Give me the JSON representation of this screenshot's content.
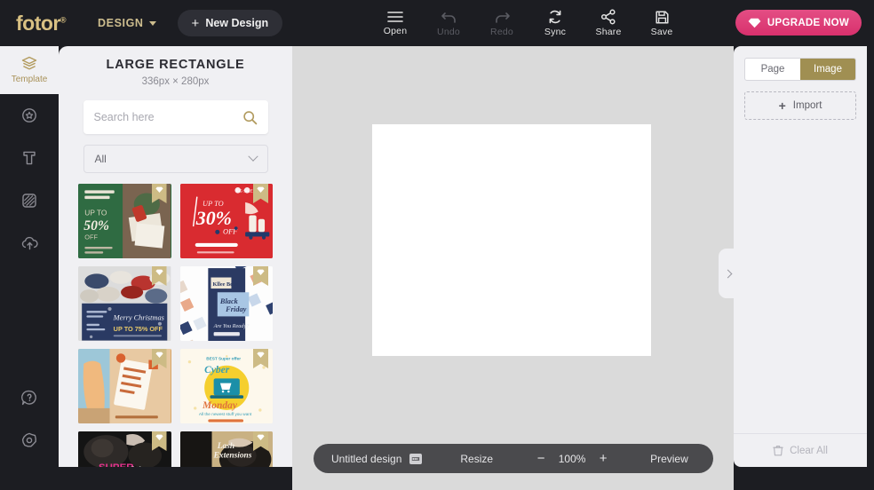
{
  "topbar": {
    "logo": "fotor",
    "logo_reg": "®",
    "design_menu": "DESIGN",
    "new_design": "New Design",
    "new_design_plus": "+",
    "tools": [
      {
        "label": "Open",
        "icon": "hamburger-menu-icon",
        "disabled": false
      },
      {
        "label": "Undo",
        "icon": "undo-arrow-icon",
        "disabled": true
      },
      {
        "label": "Redo",
        "icon": "redo-arrow-icon",
        "disabled": true
      },
      {
        "label": "Sync",
        "icon": "sync-refresh-icon",
        "disabled": false
      },
      {
        "label": "Share",
        "icon": "share-nodes-icon",
        "disabled": false
      },
      {
        "label": "Save",
        "icon": "floppy-disk-icon",
        "disabled": false
      }
    ],
    "upgrade_label": "UPGRADE NOW",
    "upgrade_icon": "diamond-icon",
    "upgrade_color": "#d8306d"
  },
  "rail": {
    "items": [
      {
        "label": "Template",
        "icon": "layers-stack-icon",
        "active": true
      },
      {
        "label": "",
        "icon": "sticker-badge-icon",
        "active": false
      },
      {
        "label": "",
        "icon": "text-T-icon",
        "active": false
      },
      {
        "label": "",
        "icon": "background-pattern-icon",
        "active": false
      },
      {
        "label": "",
        "icon": "cloud-upload-icon",
        "active": false
      }
    ],
    "bottom": [
      {
        "label": "",
        "icon": "help-question-icon"
      },
      {
        "label": "",
        "icon": "settings-gear-icon"
      }
    ]
  },
  "panel": {
    "title": "LARGE RECTANGLE",
    "subtitle": "336px × 280px",
    "search": {
      "value": "",
      "placeholder": "Search here",
      "icon": "search-magnifier-icon"
    },
    "filter": {
      "value": "All",
      "icon": "chevron-down-icon"
    },
    "badge_icon": "premium-diamond-icon",
    "templates": [
      {
        "name": "christmas-green-50-off",
        "style": "t-green",
        "wide": false,
        "premium": true
      },
      {
        "name": "red-up-to-30-percent-off",
        "style": "t-red",
        "wide": false,
        "premium": true
      },
      {
        "name": "merry-christmas-sneakers",
        "style": "t-navy",
        "wide": false,
        "premium": true
      },
      {
        "name": "black-friday-blue",
        "style": "t-bf",
        "wide": false,
        "premium": true
      },
      {
        "name": "dress-sale-tag",
        "style": "t-dress",
        "wide": false,
        "premium": true
      },
      {
        "name": "cyber-monday-yellow",
        "style": "t-cyber",
        "wide": false,
        "premium": true
      },
      {
        "name": "super-sale-dark",
        "style": "t-super",
        "wide": true,
        "premium": true
      },
      {
        "name": "lash-extensions-tan",
        "style": "t-lash",
        "wide": true,
        "premium": true
      }
    ]
  },
  "bottombar": {
    "design_name": "Untitled design",
    "rename_icon": "rename-edit-icon",
    "resize": "Resize",
    "zoom_out": "−",
    "zoom_value": "100%",
    "zoom_in": "+",
    "preview": "Preview"
  },
  "right": {
    "tabs": [
      {
        "label": "Page",
        "active": false
      },
      {
        "label": "Image",
        "active": true
      }
    ],
    "import": {
      "label": "Import",
      "plus": "+"
    },
    "clear_all": {
      "label": "Clear All",
      "icon": "trash-bin-icon"
    },
    "handle_icon": "chevron-right-icon",
    "accent_color": "#a08f52"
  }
}
